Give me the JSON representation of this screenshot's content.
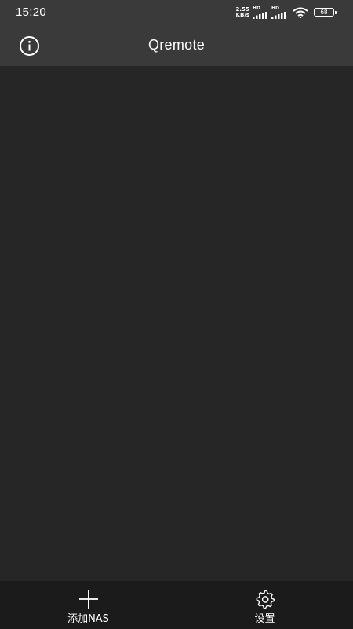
{
  "status_bar": {
    "time": "15:20",
    "speed_value": "2.55",
    "speed_unit": "KB/s",
    "signal1_label": "HD",
    "signal2_label": "HD",
    "battery_level": "68"
  },
  "header": {
    "title": "Qremote",
    "info_icon": "info-circle-icon"
  },
  "bottom_nav": {
    "items": [
      {
        "label": "添加NAS",
        "icon": "plus-icon"
      },
      {
        "label": "设置",
        "icon": "gear-icon"
      }
    ]
  },
  "colors": {
    "header_bg": "#3a3a3a",
    "content_bg": "#262626",
    "nav_bg": "#1b1b1b",
    "text": "#ffffff"
  }
}
